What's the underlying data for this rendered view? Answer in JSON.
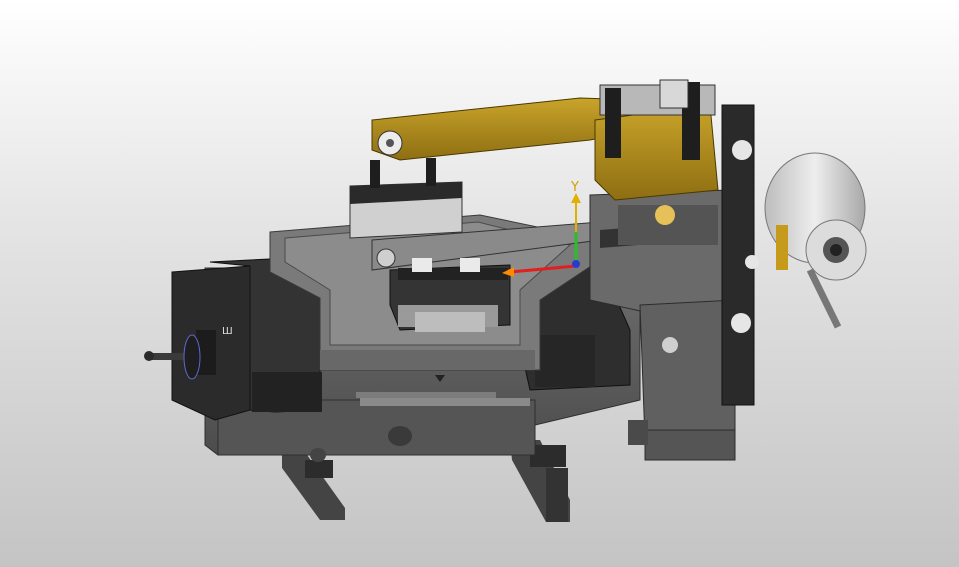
{
  "viewport": {
    "background_top": "#ffffff",
    "background_bottom": "#c4c4c4"
  },
  "model": {
    "base_color": "#5c5c5c",
    "dark_color": "#2a2a2a",
    "table_color": "#727272",
    "arm_color": "#b08c1e",
    "cylinder_color": "#d6d6d6"
  },
  "triad": {
    "y_label": "Y",
    "x_color": "#e41e1e",
    "y_color": "#e0b000",
    "z_color": "#28c028"
  },
  "nameplate": {
    "symbol": "Ш"
  }
}
